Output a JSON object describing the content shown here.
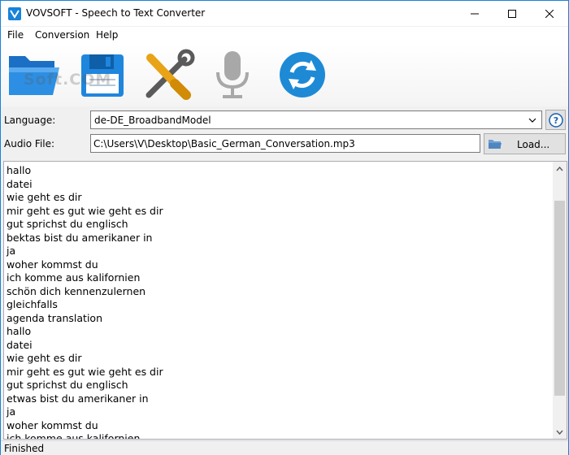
{
  "window": {
    "title": "VOVSOFT - Speech to Text Converter",
    "icons": {
      "app": "app-logo-icon",
      "minimize": "minimize-icon",
      "maximize": "maximize-icon",
      "close": "close-icon"
    }
  },
  "menu": {
    "items": [
      {
        "label": "File"
      },
      {
        "label": "Conversion"
      },
      {
        "label": "Help"
      }
    ]
  },
  "toolbar": {
    "watermark": "Soft.COM",
    "tools": [
      {
        "icon": "open-folder-icon"
      },
      {
        "icon": "floppy-disk-icon"
      },
      {
        "icon": "tools-icon"
      },
      {
        "icon": "microphone-icon"
      },
      {
        "icon": "refresh-icon"
      }
    ]
  },
  "form": {
    "language_label": "Language:",
    "language_value": "de-DE_BroadbandModel",
    "audio_label": "Audio File:",
    "audio_value": "C:\\Users\\V\\Desktop\\Basic_German_Conversation.mp3",
    "load_label": "Load..."
  },
  "transcript": {
    "lines": [
      "hallo",
      "datei",
      "wie geht es dir",
      "mir geht es gut wie geht es dir",
      "gut sprichst du englisch",
      "bektas bist du amerikaner in",
      "ja",
      "woher kommst du",
      "ich komme aus kalifornien",
      "schön dich kennenzulernen",
      "gleichfalls",
      "agenda translation",
      "hallo",
      "datei",
      "wie geht es dir",
      "mir geht es gut wie geht es dir",
      "gut sprichst du englisch",
      "etwas bist du amerikaner in",
      "ja",
      "woher kommst du",
      "ich komme aus kalifornien"
    ]
  },
  "status": {
    "text": "Finished"
  },
  "colors": {
    "accent": "#1783d9",
    "refresh": "#1e8ad6",
    "folder": "#2d8fe3"
  }
}
